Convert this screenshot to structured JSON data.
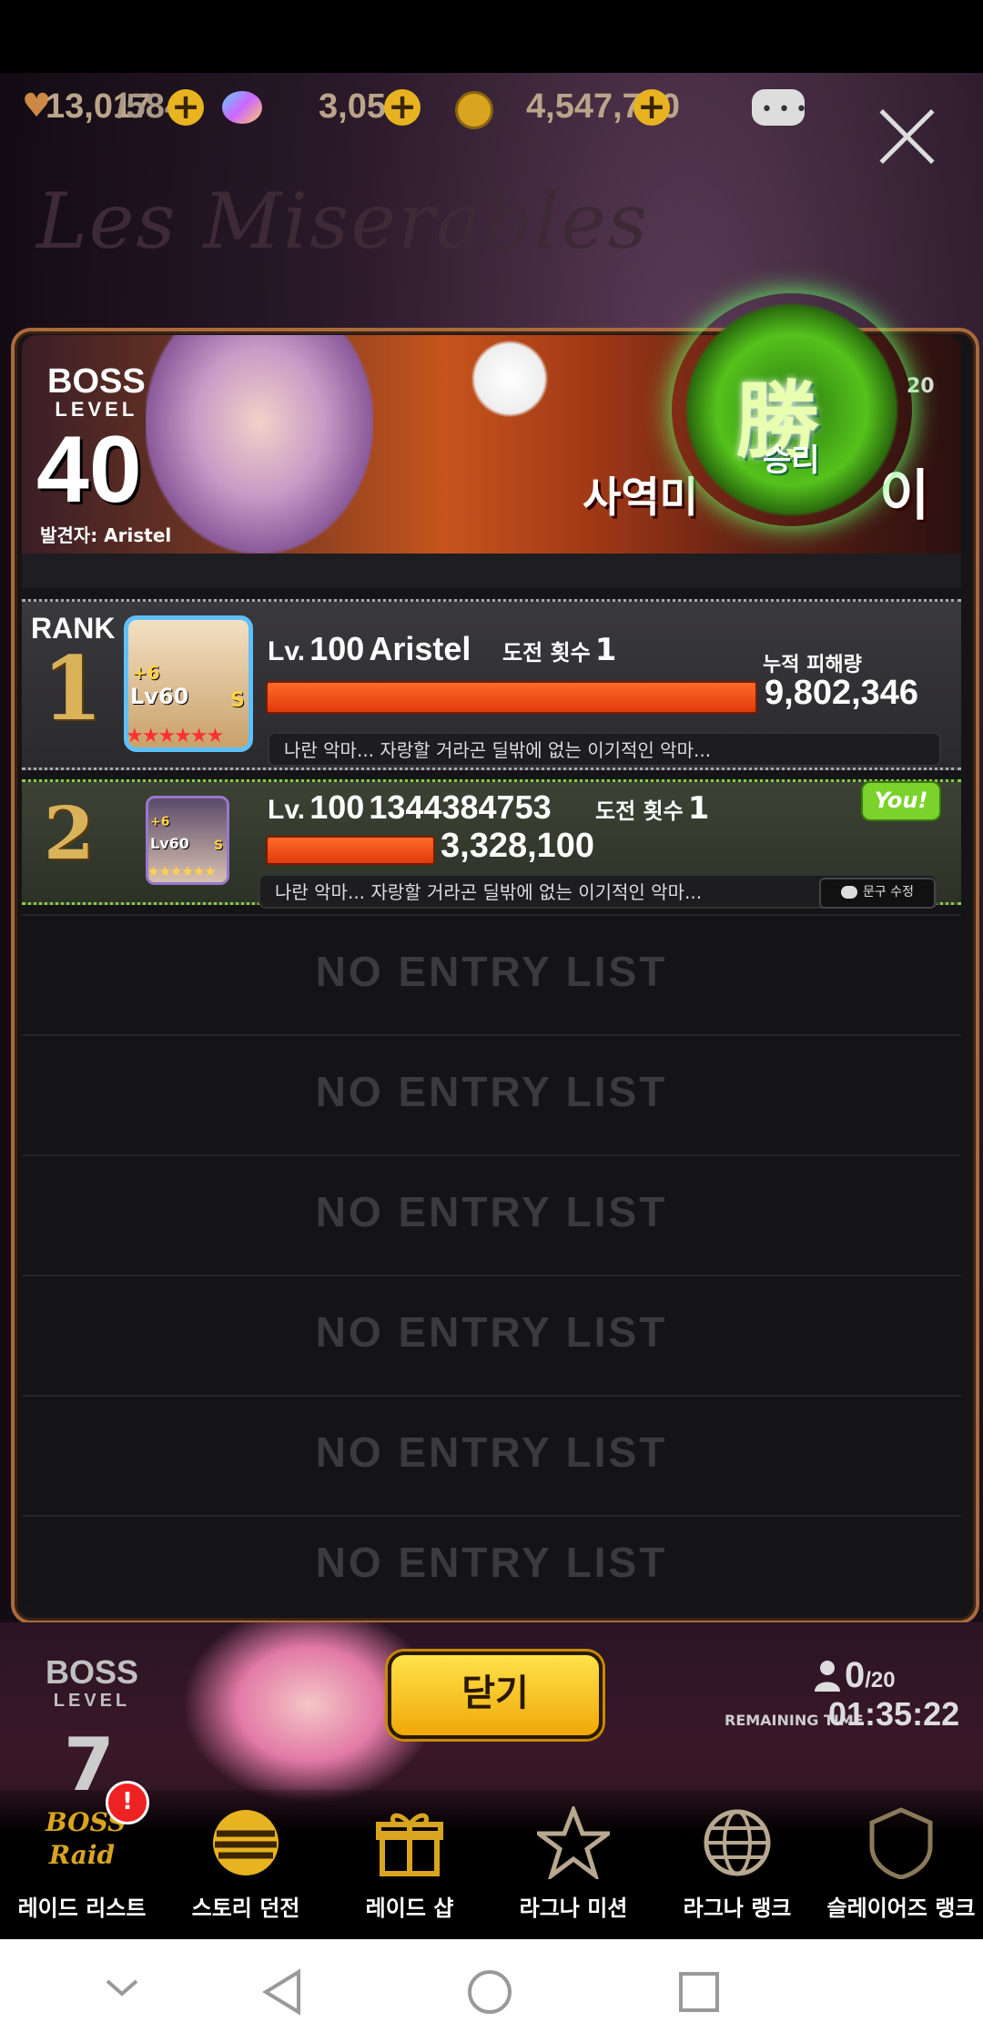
{
  "currency": {
    "hearts": "13,017",
    "hearts_max": "/584",
    "gems": "3,053",
    "gold": "4,547,790"
  },
  "background": {
    "title": "Les Miserables"
  },
  "boss": {
    "boss_word": "BOSS",
    "level_word": "LEVEL",
    "level": "40",
    "finder": "발견자: Aristel",
    "name_partial": "사역미",
    "name_tail": "이",
    "count": "20",
    "result_kanji": "勝",
    "result_label": "승리"
  },
  "ranking": {
    "rank_label": "RANK",
    "damage_label": "누적 피해량",
    "entries": [
      {
        "rank": "1",
        "lv_prefix": "Lv.",
        "level": "100",
        "name": "Aristel",
        "tries_label": "도전 횟수",
        "tries": "1",
        "damage": "9,802,346",
        "damage_fraction": 1.0,
        "avatar_lv": "Lv60",
        "avatar_plus": "+6",
        "avatar_grade": "S",
        "stars": "★★★★★★",
        "comment": "나란 악마... 자랑할 거라곤 딜밖에 없는 이기적인 악마..."
      },
      {
        "rank": "2",
        "lv_prefix": "Lv.",
        "level": "100",
        "name": "1344384753",
        "tries_label": "도전 횟수",
        "tries": "1",
        "damage": "3,328,100",
        "damage_fraction": 0.34,
        "avatar_lv": "Lv60",
        "avatar_plus": "+6",
        "avatar_grade": "S",
        "stars": "★★★★★★",
        "comment": "나란 악마... 자랑할 거라곤 딜밖에 없는 이기적인 악마...",
        "you_badge": "You!",
        "edit_label": "문구 수정"
      }
    ],
    "empty_label": "NO ENTRY LIST"
  },
  "next_boss": {
    "boss_word": "BOSS",
    "level_word": "LEVEL",
    "level": "7",
    "players": "0",
    "players_max": "/20",
    "remaining_label": "REMAINING TIME",
    "remaining_time": "01:35:22"
  },
  "close_button": "닫기",
  "nav": [
    {
      "label": "레이드 리스트",
      "icon": "boss-raid-icon",
      "badge": "!"
    },
    {
      "label": "스토리 던전",
      "icon": "story-dungeon-icon"
    },
    {
      "label": "레이드 샵",
      "icon": "gift-icon"
    },
    {
      "label": "라그나 미션",
      "icon": "mission-star-icon"
    },
    {
      "label": "라그나 랭크",
      "icon": "rank-globe-icon"
    },
    {
      "label": "슬레이어즈 랭크",
      "icon": "slayers-rank-icon"
    }
  ],
  "colors": {
    "accent": "#e8b320",
    "damage_bar": "#ff5a1a",
    "panel_border": "#a96a3c",
    "you_badge": "#7bd22a"
  }
}
